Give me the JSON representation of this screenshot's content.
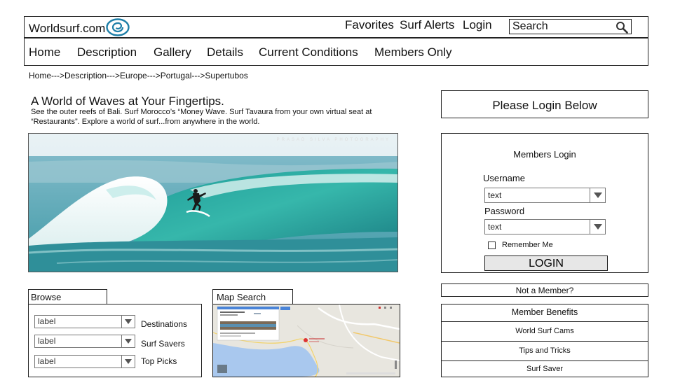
{
  "header": {
    "logo_text": "Worldsurf.com",
    "links": [
      "Favorites",
      "Surf Alerts",
      "Login"
    ],
    "search_placeholder": "Search"
  },
  "nav": {
    "items": [
      "Home",
      "Description",
      "Gallery",
      "Details",
      "Current Conditions",
      "Members Only"
    ]
  },
  "breadcrumb": "Home--->Description--->Europe--->Portugal--->Supertubos",
  "hero": {
    "title": "A World of Waves at Your Fingertips.",
    "text": "See the outer reefs of Bali.  Surf Morocco’s “Money Wave. Surf Tavaura from your own virtual seat at “Restaurants”.  Explore a world of surf...from anywhere in the world.",
    "watermark": "PRASAD SILVA PHOTOGRAPHY"
  },
  "browse": {
    "tab_label": "Browse",
    "rows": [
      {
        "select_value": "label",
        "label": "Destinations"
      },
      {
        "select_value": "label",
        "label": "Surf Savers"
      },
      {
        "select_value": "label",
        "label": "Top Picks"
      }
    ]
  },
  "map": {
    "tab_label": "Map Search"
  },
  "login": {
    "header": "Please Login Below",
    "panel_title": "Members Login",
    "username_label": "Username",
    "username_value": "text",
    "password_label": "Password",
    "password_value": "text",
    "remember_label": "Remember Me",
    "button_label": "LOGIN"
  },
  "not_member": "Not a Member?",
  "benefits": {
    "title": "Member Benefits",
    "items": [
      "World Surf Cams",
      "Tips and Tricks",
      "Surf Saver"
    ]
  },
  "colors": {
    "border": "#222222",
    "button_bg": "#e7e7e7",
    "logo_blue": "#1e7fa8",
    "sea": "#2aa7a0"
  }
}
